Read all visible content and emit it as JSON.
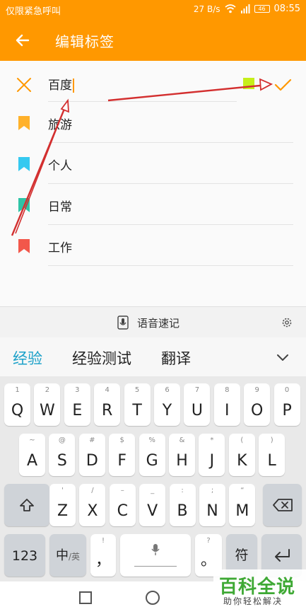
{
  "status_bar": {
    "carrier": "仅限紧急呼叫",
    "net_speed": "27 B/s",
    "battery": "46",
    "time": "08:55"
  },
  "header": {
    "title": "编辑标签"
  },
  "edit_row": {
    "input_value": "百度"
  },
  "tags": [
    {
      "label": "旅游",
      "color": "#ffb12a"
    },
    {
      "label": "个人",
      "color": "#35c9f0"
    },
    {
      "label": "日常",
      "color": "#2ec4a6"
    },
    {
      "label": "工作",
      "color": "#f2574b"
    }
  ],
  "voice_bar": {
    "label": "语音速记"
  },
  "suggestions": [
    "经验",
    "经验测试",
    "翻译"
  ],
  "keyboard": {
    "row1": [
      {
        "key": "Q",
        "hint": "1"
      },
      {
        "key": "W",
        "hint": "2"
      },
      {
        "key": "E",
        "hint": "3"
      },
      {
        "key": "R",
        "hint": "4"
      },
      {
        "key": "T",
        "hint": "5"
      },
      {
        "key": "Y",
        "hint": "6"
      },
      {
        "key": "U",
        "hint": "7"
      },
      {
        "key": "I",
        "hint": "8"
      },
      {
        "key": "O",
        "hint": "9"
      },
      {
        "key": "P",
        "hint": "0"
      }
    ],
    "row2": [
      {
        "key": "A",
        "hint": "~"
      },
      {
        "key": "S",
        "hint": "@"
      },
      {
        "key": "D",
        "hint": "#"
      },
      {
        "key": "F",
        "hint": "$"
      },
      {
        "key": "G",
        "hint": "%"
      },
      {
        "key": "H",
        "hint": "&"
      },
      {
        "key": "J",
        "hint": "*"
      },
      {
        "key": "K",
        "hint": "("
      },
      {
        "key": "L",
        "hint": ")"
      }
    ],
    "row3": [
      {
        "key": "Z",
        "hint": "'"
      },
      {
        "key": "X",
        "hint": "/"
      },
      {
        "key": "C",
        "hint": "–"
      },
      {
        "key": "V",
        "hint": "_"
      },
      {
        "key": "B",
        "hint": ":"
      },
      {
        "key": "N",
        "hint": ";"
      },
      {
        "key": "M",
        "hint": "“"
      }
    ],
    "num_key": "123",
    "lang_key_main": "中",
    "lang_key_sub": "/英",
    "comma_key": "，",
    "comma_hint": "!",
    "period_key": "。",
    "period_hint": "?",
    "symbol_key": "符"
  },
  "watermark": {
    "title": "百科全说",
    "subtitle": "助你轻松解决"
  },
  "colors": {
    "accent": "#ff9800",
    "suggest_active": "#1aa0c8",
    "annotation_arrow": "#d32f2f"
  }
}
